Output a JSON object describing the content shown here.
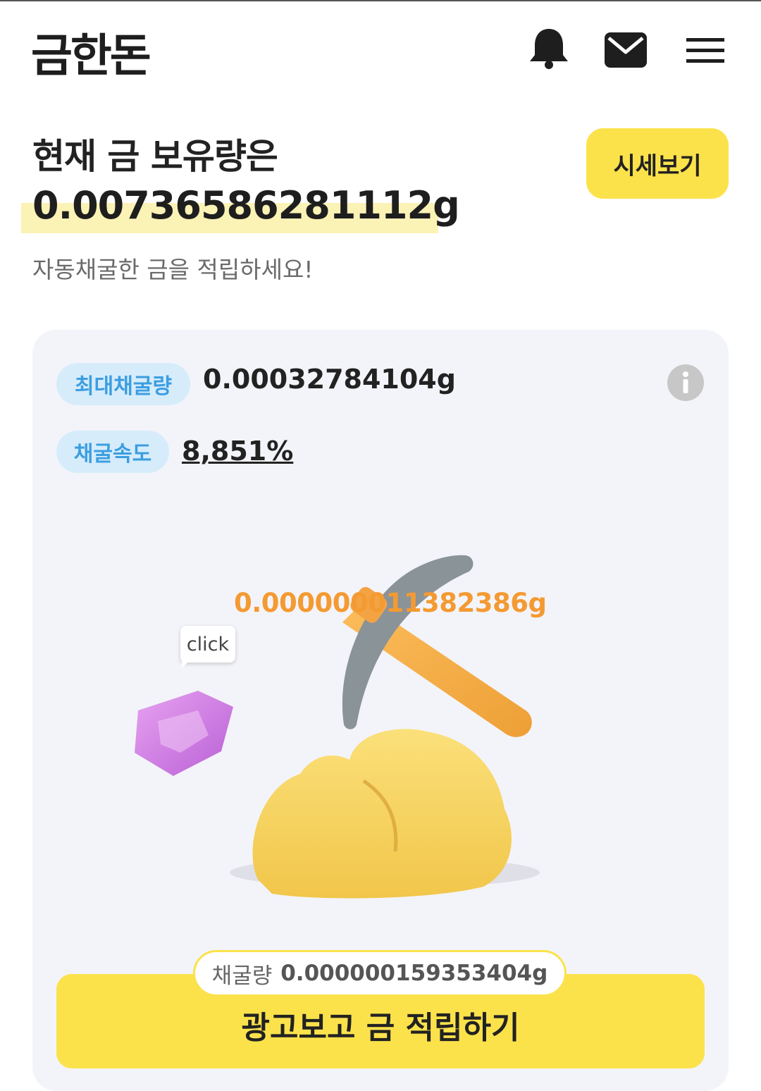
{
  "header": {
    "logo": "금한돈",
    "icons": [
      "bell-icon",
      "mail-icon",
      "menu-icon"
    ]
  },
  "balance": {
    "title": "현재 금 보유량은",
    "amount": "0.00736586281112g",
    "subtitle": "자동채굴한 금을 적립하세요!",
    "price_button": "시세보기"
  },
  "mining": {
    "max_label": "최대채굴량",
    "max_value": "0.00032784104g",
    "speed_label": "채굴속도",
    "speed_value": "8,851%",
    "floating_amount": "0.000000011382386g",
    "click_hint": "click",
    "mined_label": "채굴량",
    "mined_value": "0.000000159353404g",
    "ad_button": "광고보고 금 적립하기"
  },
  "colors": {
    "accent_yellow": "#fbe24b",
    "highlight": "#fbf2b6",
    "pill_bg": "#d6ecfb",
    "pill_text": "#3c9ee0",
    "orange_text": "#f49a32",
    "card_bg": "#f3f4f9"
  }
}
